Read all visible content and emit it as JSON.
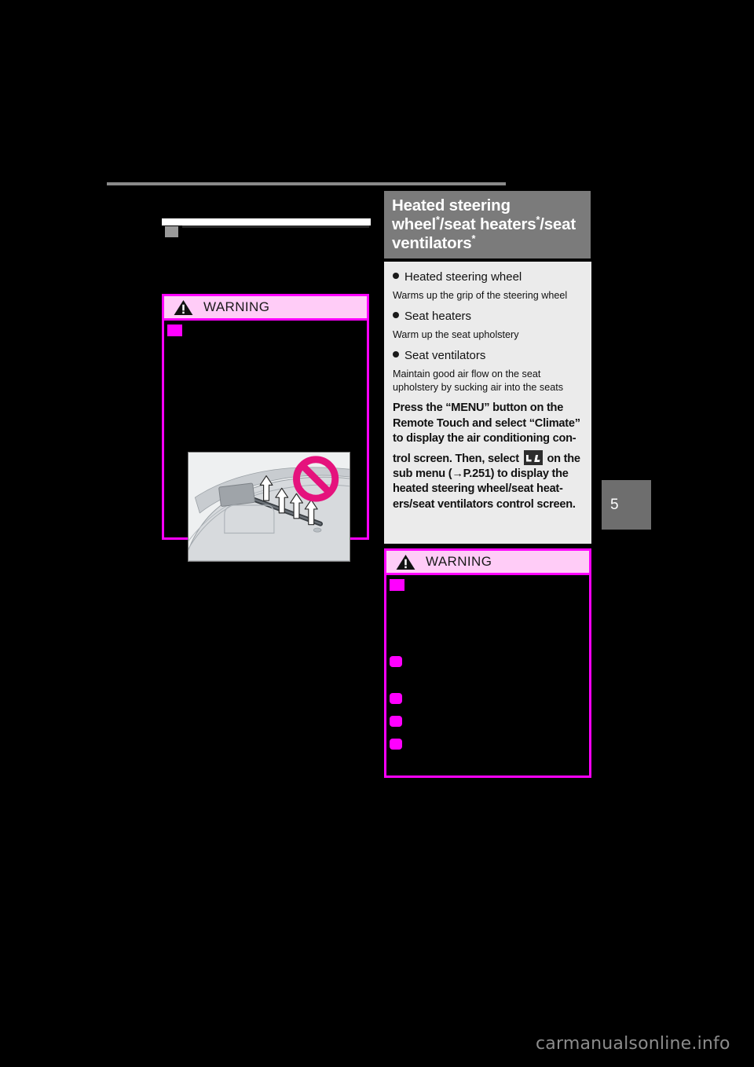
{
  "page": {
    "chapter_tab": "5",
    "watermark": "carmanualsonline.info"
  },
  "section": {
    "title_line1_a": "Heated steering wheel",
    "title_line1_sup": "*",
    "title_line1_b": "/seat",
    "title_line2_a": "heaters",
    "title_line2_sup": "*",
    "title_line2_b": "/seat ventilators",
    "title_line2_sup2": "*"
  },
  "features": [
    {
      "name": "Heated steering wheel",
      "description": "Warms up the grip of the steering wheel"
    },
    {
      "name": "Seat heaters",
      "description": "Warm up the seat upholstery"
    },
    {
      "name": "Seat ventilators",
      "description": "Maintain good air flow on the seat upholstery by sucking air into the seats"
    }
  ],
  "instructions": {
    "part1": "Press the “MENU” button on the Remote Touch and select “Climate” to display the air conditioning con-",
    "part2_before_icon": "trol screen. Then, select",
    "icon_name": "seat-heater-ventilator-button-icon",
    "part2_after_icon": "on the sub menu (→P.251) to display the heated steering wheel/seat heat-ers/seat ventilators control screen."
  },
  "warnings": {
    "left": {
      "label": "WARNING",
      "icon": "warning-triangle-icon",
      "illustration_name": "dashboard-defroster-vent-illustration",
      "illustration_prohibition": "prohibition-icon"
    },
    "right": {
      "label": "WARNING",
      "icon": "warning-triangle-icon"
    }
  }
}
